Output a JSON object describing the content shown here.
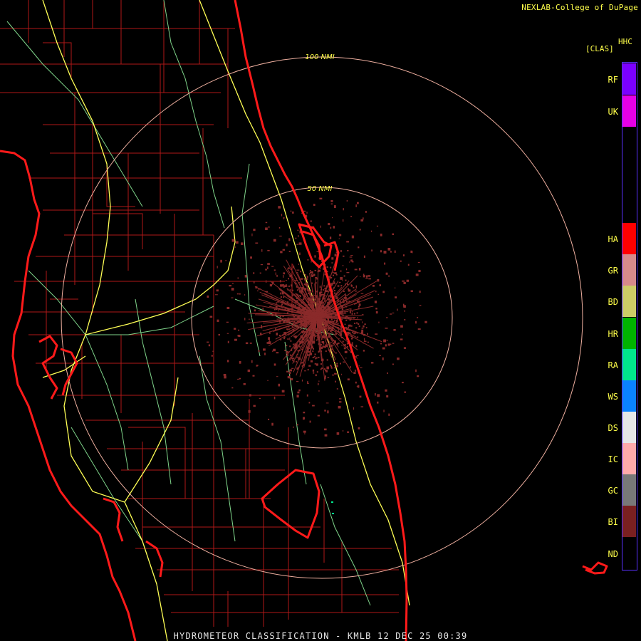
{
  "credit": "NEXLAB-College of DuPage",
  "footer": "HYDROMETEOR CLASSIFICATION - KMLB 12 DEC 25 00:39",
  "legend": {
    "product": "HHC",
    "units": "[CLAS]",
    "categories": [
      {
        "code": "RF",
        "color": "#7b00ff"
      },
      {
        "code": "UK",
        "color": "#e600e6"
      },
      {
        "code": "HA",
        "color": "#ff0000"
      },
      {
        "code": "GR",
        "color": "#d68a8a"
      },
      {
        "code": "BD",
        "color": "#cccc66"
      },
      {
        "code": "HR",
        "color": "#00b400"
      },
      {
        "code": "RA",
        "color": "#00e68c"
      },
      {
        "code": "WS",
        "color": "#0a82ff"
      },
      {
        "code": "DS",
        "color": "#e6e6e6"
      },
      {
        "code": "IC",
        "color": "#ffaaaa"
      },
      {
        "code": "GC",
        "color": "#787878"
      },
      {
        "code": "BI",
        "color": "#7a2020"
      },
      {
        "code": "ND",
        "color": "#000000"
      }
    ]
  },
  "rings": [
    {
      "label": "50 NMI"
    },
    {
      "label": "100 NMI"
    }
  ],
  "colors": {
    "coast": "#ff1a1a",
    "county": "#b01818",
    "interstate": "#ffff55",
    "highway": "#7fd48a",
    "ring": "#f0b0a0",
    "echo": "#8a2a2a"
  }
}
